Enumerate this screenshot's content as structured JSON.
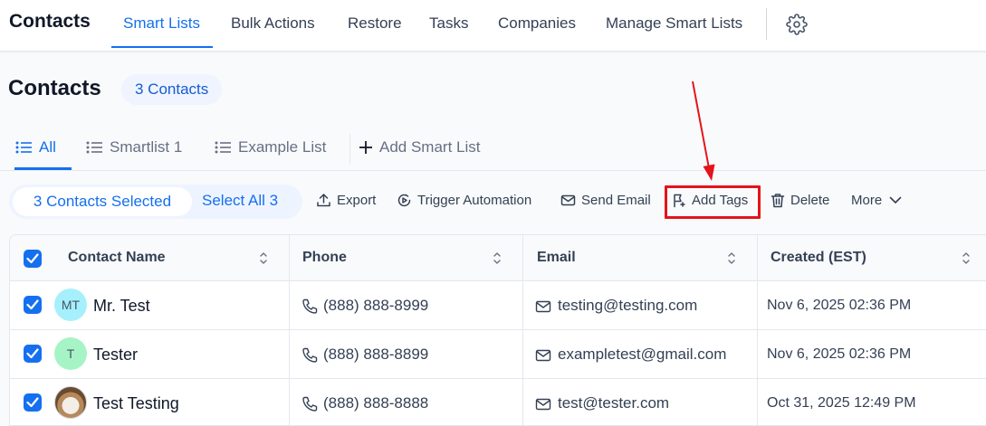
{
  "topnav": {
    "title": "Contacts",
    "items": [
      "Smart Lists",
      "Bulk Actions",
      "Restore",
      "Tasks",
      "Companies",
      "Manage Smart Lists"
    ],
    "active": "Smart Lists",
    "settings_icon": "gear-icon"
  },
  "page": {
    "title": "Contacts",
    "count_badge": "3 Contacts"
  },
  "list_tabs": {
    "items": [
      "All",
      "Smartlist 1",
      "Example List"
    ],
    "active": "All",
    "add_label": "Add Smart List"
  },
  "actions": {
    "selected_label": "3 Contacts Selected",
    "select_all_label": "Select All 3",
    "export": "Export",
    "trigger_automation": "Trigger Automation",
    "send_email": "Send Email",
    "add_tags": "Add Tags",
    "delete": "Delete",
    "more": "More",
    "highlighted": "Add Tags"
  },
  "table": {
    "columns": [
      "Contact Name",
      "Phone",
      "Email",
      "Created (EST)"
    ],
    "rows": [
      {
        "initials": "MT",
        "avatar_color": "#a5f0fc",
        "name": "Mr. Test",
        "phone": "(888) 888-8999",
        "email": "testing@testing.com",
        "created": "Nov 6, 2025 02:36 PM",
        "checked": true
      },
      {
        "initials": "T",
        "avatar_color": "#a6f4c5",
        "name": "Tester",
        "phone": "(888) 888-8899",
        "email": "exampletest@gmail.com",
        "created": "Nov 6, 2025 02:36 PM",
        "checked": true
      },
      {
        "initials": "",
        "avatar_color": "#d6c7b3",
        "name": "Test Testing",
        "phone": "(888) 888-8888",
        "email": "test@tester.com",
        "created": "Oct 31, 2025 12:49 PM",
        "checked": true
      }
    ]
  },
  "colors": {
    "accent": "#1570ef",
    "highlight": "#e5131a"
  }
}
